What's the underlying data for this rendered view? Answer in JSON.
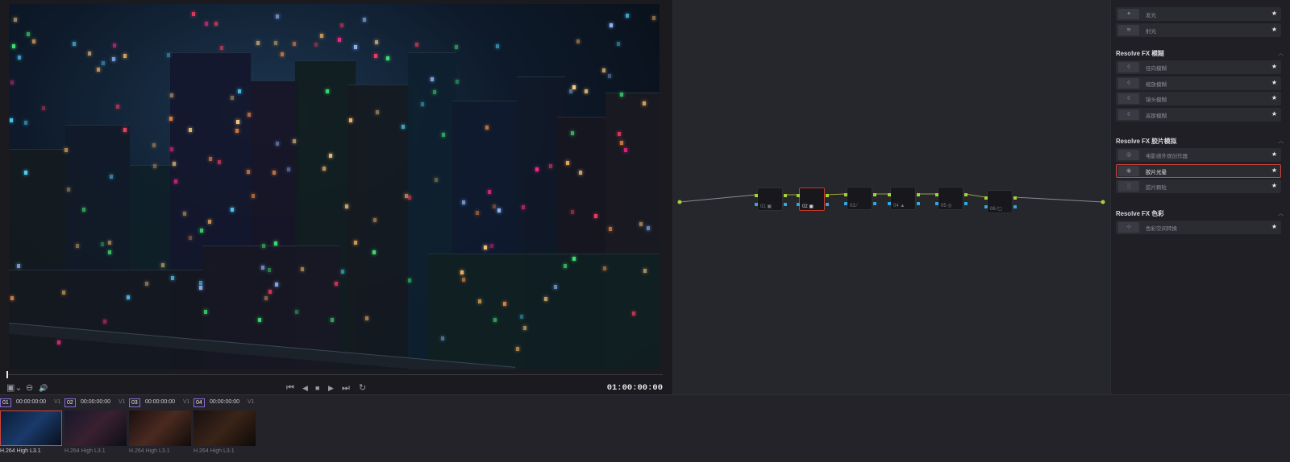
{
  "viewer": {
    "timecode": "01:00:00:00",
    "controls": {
      "first": "⏮",
      "prev": "◀",
      "stop": "■",
      "play": "▶",
      "last": "⏭",
      "loop": "↻",
      "viewer_mode": "▣⌄",
      "mute": "🔊",
      "volume": "⊖"
    }
  },
  "node_editor": {
    "nodes": [
      {
        "label": "01 ▣"
      },
      {
        "label": "02 ▣"
      },
      {
        "label": "03 ⁄"
      },
      {
        "label": "04 ▲"
      },
      {
        "label": "05 ◎"
      },
      {
        "label": "06 ⁄▢"
      }
    ],
    "selected_index": 1,
    "link_color": "#9aa03a",
    "port_green": "#a6d232",
    "port_blue": "#2fa8e0"
  },
  "fx_panel": {
    "top_items": [
      {
        "name": "发光",
        "thumb": "✦"
      },
      {
        "name": "射光",
        "thumb": "≋"
      }
    ],
    "sections": [
      {
        "title": "Resolve FX 模糊",
        "items": [
          {
            "name": "径向模糊",
            "thumb": "◊"
          },
          {
            "name": "缩放模糊",
            "thumb": "◊"
          },
          {
            "name": "镜头模糊",
            "thumb": "◊"
          },
          {
            "name": "高斯模糊",
            "thumb": "◊"
          }
        ]
      },
      {
        "title": "Resolve FX 胶片模拟",
        "items": [
          {
            "name": "电影感外观创作器",
            "thumb": "◎"
          },
          {
            "name": "胶片光晕",
            "thumb": "◉"
          },
          {
            "name": "胶片颗粒",
            "thumb": "░"
          }
        ]
      },
      {
        "title": "Resolve FX 色彩",
        "items": [
          {
            "name": "色彩空间转换",
            "thumb": "⊹"
          }
        ]
      }
    ],
    "selected_item": "胶片光晕",
    "star": "★",
    "chevron": "︿"
  },
  "clips": [
    {
      "num": "01",
      "timecode": "00:00:00:00",
      "track": "V1",
      "codec": "H.264 High L3.1"
    },
    {
      "num": "02",
      "timecode": "00:00:00:00",
      "track": "V1",
      "codec": "H.264 High L3.1"
    },
    {
      "num": "03",
      "timecode": "00:00:00:00",
      "track": "V1",
      "codec": "H.264 High L3.1"
    },
    {
      "num": "04",
      "timecode": "00:00:00:00",
      "track": "V1",
      "codec": "H.264 High L3.1"
    }
  ]
}
